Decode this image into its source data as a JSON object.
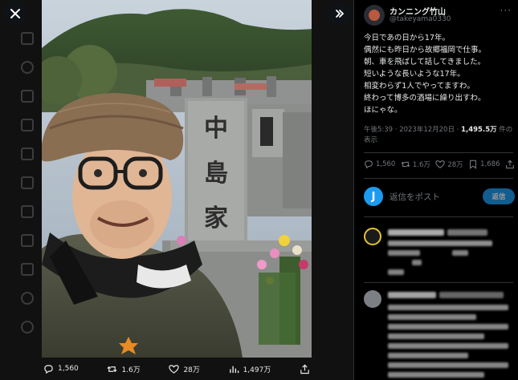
{
  "viewer": {
    "close_icon": "close-icon",
    "expand_icon": "expand-icon"
  },
  "photo": {
    "gravestone_chars": [
      "中",
      "島",
      "家"
    ]
  },
  "media_bar": {
    "replies": "1,560",
    "reposts": "1.6万",
    "likes": "28万",
    "views": "1,497万"
  },
  "tweet": {
    "author_name": "カンニング竹山",
    "author_handle": "@takeyama0330",
    "lines": [
      "今日であの日から17年。",
      "偶然にも昨日から故郷福岡で仕事。",
      "朝、車を飛ばして話してきました。",
      "短いような長いような17年。",
      "相変わらず1人でやってますわ。",
      "終わって博多の酒場に繰り出すわ。",
      "ほにゃな。"
    ],
    "time": "午後5:39 · 2023年12月20日 · ",
    "view_count": "1,495.5万",
    "view_suffix": " 件の",
    "view_suffix2": "表示"
  },
  "stats": {
    "replies": "1,560",
    "reposts": "1.6万",
    "likes": "28万",
    "bookmarks": "1,686"
  },
  "reply_box": {
    "avatar_letter": "J",
    "placeholder": "返信をポスト",
    "button": "返信"
  },
  "colors": {
    "accent": "#1d9bf0",
    "background": "#000000",
    "muted": "#71767b"
  }
}
